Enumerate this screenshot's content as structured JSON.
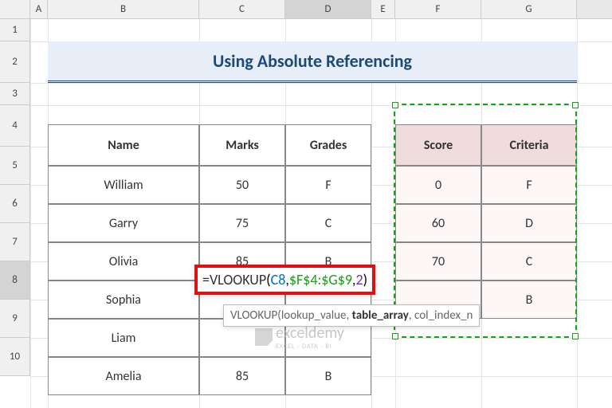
{
  "columns": [
    {
      "label": "",
      "w": 38
    },
    {
      "label": "A",
      "w": 22
    },
    {
      "label": "B",
      "w": 190
    },
    {
      "label": "C",
      "w": 108
    },
    {
      "label": "D",
      "w": 108
    },
    {
      "label": "E",
      "w": 30
    },
    {
      "label": "F",
      "w": 108
    },
    {
      "label": "G",
      "w": 120
    }
  ],
  "rows": [
    {
      "label": "1",
      "h": 28
    },
    {
      "label": "2",
      "h": 52
    },
    {
      "label": "3",
      "h": 28
    },
    {
      "label": "4",
      "h": 52
    },
    {
      "label": "5",
      "h": 48
    },
    {
      "label": "6",
      "h": 48
    },
    {
      "label": "7",
      "h": 48
    },
    {
      "label": "8",
      "h": 48
    },
    {
      "label": "9",
      "h": 48
    },
    {
      "label": "10",
      "h": 48
    }
  ],
  "selected_col": "D",
  "selected_row": "8",
  "title": "Using Absolute Referencing",
  "table1": {
    "headers": [
      "Name",
      "Marks",
      "Grades"
    ],
    "rows": [
      [
        "William",
        "50",
        "F"
      ],
      [
        "Garry",
        "75",
        "C"
      ],
      [
        "Olivia",
        "85",
        "B"
      ],
      [
        "Sophia",
        "",
        ""
      ],
      [
        "Liam",
        "",
        ""
      ],
      [
        "Amelia",
        "85",
        "B"
      ]
    ]
  },
  "table2": {
    "headers": [
      "Score",
      "Criteria"
    ],
    "rows": [
      [
        "0",
        "F"
      ],
      [
        "60",
        "D"
      ],
      [
        "70",
        "C"
      ],
      [
        "",
        "B"
      ]
    ]
  },
  "formula": {
    "eq": "=",
    "fn": "VLOOKUP",
    "open": "(",
    "arg1": "C8",
    "c1": ",",
    "arg2": "$F$4:$G$9",
    "c2": ",",
    "arg3": "2",
    "close": ")"
  },
  "tooltip": {
    "fn": "VLOOKUP(",
    "p1": "lookup_value",
    "s1": ", ",
    "p2": "table_array",
    "s2": ", ",
    "p3": "col_index_n"
  },
  "watermark": "exceldemy",
  "watermark_sub": "EXCEL · DATA · BI"
}
